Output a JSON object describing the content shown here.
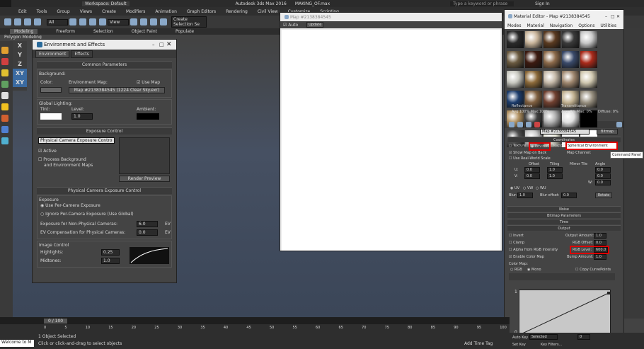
{
  "app": {
    "workspace": "Workspace: Default",
    "title": "Autodesk 3ds Max 2016",
    "file": "MAKING_OF.max",
    "search": "Type a keyword or phrase",
    "signin": "Sign In"
  },
  "menu": [
    "Edit",
    "Tools",
    "Group",
    "Views",
    "Create",
    "Modifiers",
    "Animation",
    "Graph Editors",
    "Rendering",
    "Civil View",
    "Customize",
    "Scripting"
  ],
  "toolbar": {
    "filter": "All",
    "view": "View",
    "create_sel": "Create Selection Se"
  },
  "ribbon": [
    "Modeling",
    "Freeform",
    "Selection",
    "Object Paint",
    "Populate"
  ],
  "ribbon_sub": "Polygon Modeling",
  "axes": [
    "X",
    "Y",
    "Z",
    "XY",
    "XY"
  ],
  "env": {
    "title": "Environment and Effects",
    "tabs": [
      "Environment",
      "Effects"
    ],
    "common": "Common Parameters",
    "background": "Background:",
    "color": "Color:",
    "env_map": "Environment Map:",
    "use_map": "Use Map",
    "map_name": "Map #2138384545 (1224 Clear Sky.exr)",
    "global": "Global Lighting:",
    "tint": "Tint:",
    "level": "Level:",
    "level_val": "1.0",
    "ambient": "Ambient:",
    "exposure": "Exposure Control",
    "exp_type": "Physical Camera Exposure Contro",
    "active": "Active",
    "process": "Process Background",
    "process2": "and Environment Maps",
    "render_preview": "Render Preview",
    "phys": "Physical Camera Exposure Control",
    "exposure_lbl": "Exposure",
    "per_cam": "Use Per-Camera Exposure",
    "ignore": "Ignore Per-Camera Exposure (Use Global)",
    "non_phys": "Exposure for Non-Physical Cameras:",
    "non_phys_val": "6.0",
    "ev": "EV",
    "ev_comp": "EV Compensation for Physical Cameras:",
    "ev_comp_val": "0.0",
    "image_ctrl": "Image Control",
    "highlights": "Highlights:",
    "highlights_val": "0.25",
    "midtones": "Midtones:",
    "midtones_val": "1.0"
  },
  "mapwin": {
    "title": "Map #2138384545",
    "auto": "Auto",
    "update": "Update"
  },
  "mated": {
    "title": "Material Editor - Map #2138384545",
    "menu": [
      "Modes",
      "Material",
      "Navigation",
      "Options",
      "Utilities"
    ],
    "reflectance": "Reflectance",
    "refl_vals": "Avg:100% Max:100%",
    "transmittance": "Transmittance",
    "trans_vals": "Avg: 0% Max: 0%",
    "diffuse": "Diffuse: 0%",
    "map_name": "Map #2138384545",
    "bitmap": "Bitmap",
    "coords": "Coordinates",
    "texture": "Texture",
    "environ": "Environ",
    "mapping": "Mapping:",
    "mapping_val": "Spherical Environment",
    "show_map": "Show Map on Back",
    "map_channel": "Map Channel:",
    "use_real": "Use Real-World Scale",
    "offset": "Offset",
    "tiling": "Tiling",
    "mirror": "Mirror Tile",
    "angle": "Angle",
    "u": "U:",
    "v": "V:",
    "w": "W:",
    "u_off": "0.0",
    "u_til": "1.0",
    "u_ang": "0.0",
    "v_off": "0.0",
    "v_til": "1.0",
    "v_ang": "0.0",
    "w_ang": "0.0",
    "uv": "UV",
    "vw": "VW",
    "wu": "WU",
    "blur": "Blur:",
    "blur_val": "1.0",
    "blur_off": "Blur offset:",
    "blur_off_val": "0.0",
    "rotate": "Rotate",
    "noise": "Noise",
    "bitmap_params": "Bitmap Parameters",
    "time": "Time",
    "output": "Output",
    "invert": "Invert",
    "output_amt": "Output Amount:",
    "output_amt_val": "1.0",
    "clamp": "Clamp",
    "rgb_offset": "RGB Offset:",
    "rgb_offset_val": "0.0",
    "alpha": "Alpha from RGB Intensity",
    "rgb_level": "RGB Level:",
    "rgb_level_val": "600.0",
    "enable_color": "Enable Color Map",
    "bump": "Bump Amount:",
    "bump_val": "1.0",
    "color_map": "Color Map:",
    "rgb": "RGB",
    "mono": "Mono",
    "copy_curve": "Copy CurvePoints",
    "command_panel": "Command Panel",
    "curve_top": "1",
    "curve_bot": "0"
  },
  "swatches": [
    "#2a2a2a",
    "#c8b49a",
    "#5a3a20",
    "#3a3a3a",
    "#c8c8c8",
    "#6a5a40",
    "#3c1a10",
    "#8c6a4a",
    "#3a4a6a",
    "#aa2a1a",
    "#c8c8c0",
    "#8c6a3a",
    "#c4b8a8",
    "#a08870",
    "#d0c8b0",
    "#1c3c6c",
    "#806040",
    "#704030",
    "#c0b090",
    "#989080",
    "#b09060",
    "#404040",
    "#b0b0b0",
    "#e0e0e0",
    "#000000",
    "#505050",
    "#c8c8c8",
    "#f0f0e0",
    "#ffffff",
    "#ffffff"
  ],
  "timeline": {
    "frame": "0 / 100",
    "ticks": [
      "0",
      "5",
      "10",
      "15",
      "20",
      "25",
      "30",
      "35",
      "40",
      "45",
      "50",
      "55",
      "60",
      "65",
      "70",
      "75",
      "80",
      "85",
      "90",
      "95",
      "100"
    ],
    "welcome": "Welcome to M",
    "selected": "1 Object Selected",
    "hint": "Click or click-and-drag to select objects",
    "add_tag": "Add Time Tag",
    "auto_key": "Auto Key",
    "set_key": "Set Key",
    "selected_dd": "Selected",
    "key_filters": "Key Filters...",
    "frame_num": "0"
  }
}
